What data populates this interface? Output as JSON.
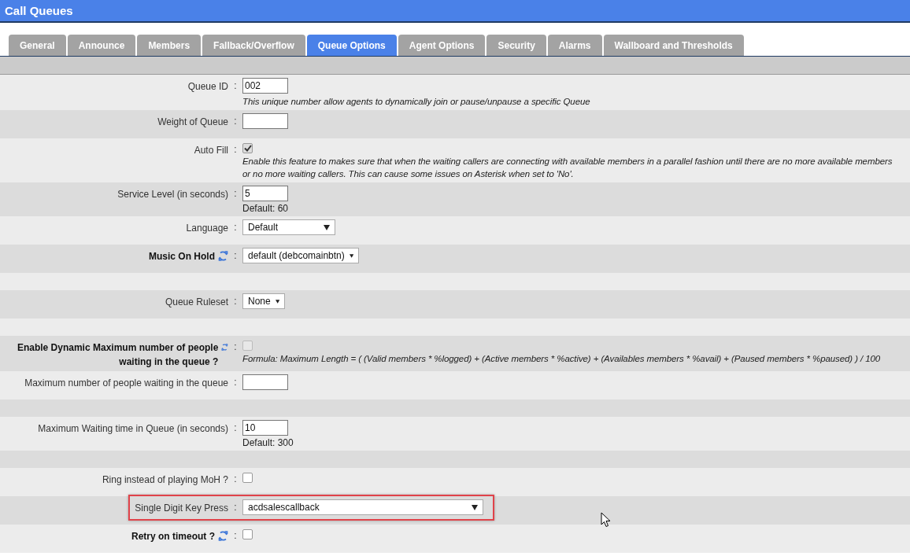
{
  "window": {
    "title": "Call Queues"
  },
  "tabs": [
    {
      "label": "General",
      "selected": false
    },
    {
      "label": "Announce",
      "selected": false
    },
    {
      "label": "Members",
      "selected": false
    },
    {
      "label": "Fallback/Overflow",
      "selected": false
    },
    {
      "label": "Queue Options",
      "selected": true
    },
    {
      "label": "Agent Options",
      "selected": false
    },
    {
      "label": "Security",
      "selected": false
    },
    {
      "label": "Alarms",
      "selected": false
    },
    {
      "label": "Wallboard and Thresholds",
      "selected": false
    }
  ],
  "rows": [
    {
      "kind": "text",
      "label": "Queue ID",
      "separator": ":",
      "value": "002",
      "help": "This unique number allow agents to dynamically join or pause/unpause a specific Queue"
    },
    {
      "kind": "text",
      "label": "Weight of Queue",
      "separator": ":"
    },
    {
      "kind": "checkbox",
      "label": "Auto Fill",
      "separator": ":",
      "checked": true,
      "help": "Enable this feature to makes sure that when the waiting callers are connecting with available members in a parallel fashion until there are no more available members or no more waiting callers. This can cause some issues on Asterisk when set to 'No'."
    },
    {
      "kind": "text",
      "label": "Service Level (in seconds)",
      "separator": ":",
      "value": "5",
      "note": "Default: 60"
    },
    {
      "kind": "select",
      "label": "Language",
      "separator": ":",
      "value": "Default"
    },
    {
      "kind": "select",
      "label": "Music On Hold",
      "separator": ":",
      "bold": true,
      "refresh": true,
      "value": "default (debcomainbtn)"
    },
    {
      "kind": "blank"
    },
    {
      "kind": "select",
      "label": "Queue Ruleset",
      "separator": ":",
      "value": "None"
    },
    {
      "kind": "blank"
    },
    {
      "kind": "checkbox",
      "label": "Enable Dynamic Maximum number of people waiting in the queue ?",
      "separator": ":",
      "bold": true,
      "refresh": true,
      "checked": false,
      "disabled": true,
      "help": "Formula: Maximum Length = ( (Valid members * %logged) + (Active members * %active) + (Availables members * %avail) + (Paused members * %paused) ) / 100"
    },
    {
      "kind": "text",
      "label": "Maximum number of people waiting in the queue",
      "separator": ":"
    },
    {
      "kind": "blank"
    },
    {
      "kind": "text",
      "label": "Maximum Waiting time in Queue (in seconds)",
      "separator": ":",
      "value": "10",
      "note": "Default: 300"
    },
    {
      "kind": "blank"
    },
    {
      "kind": "checkbox",
      "label": "Ring instead of playing MoH ?",
      "separator": ":",
      "checked": false
    },
    {
      "kind": "select",
      "label": "Single Digit Key Press",
      "separator": ":",
      "value": "acdsalescallback",
      "highlighted": true
    },
    {
      "kind": "checkbox",
      "label": "Retry on timeout ?",
      "separator": ":",
      "bold": true,
      "refresh": true,
      "checked": false
    }
  ]
}
